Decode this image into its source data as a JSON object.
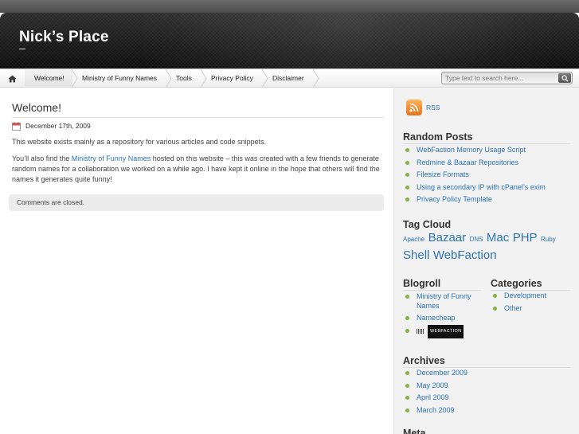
{
  "site": {
    "title": "Nick’s Place"
  },
  "nav": {
    "home_icon": "home-icon",
    "items": [
      {
        "label": "Welcome!"
      },
      {
        "label": "Ministry of Funny Names"
      },
      {
        "label": "Tools"
      },
      {
        "label": "Privacy Policy"
      },
      {
        "label": "Disclaimer"
      }
    ],
    "search": {
      "placeholder": "Type text to search here...",
      "button_icon": "magnifier-icon"
    }
  },
  "post": {
    "title": "Welcome!",
    "date": "December 17th, 2009",
    "paragraph1": "This website exists mainly as a repository for various articles and code snippets.",
    "paragraph2_before": "You’ll also find the ",
    "paragraph2_link": "Ministry of Funny Names",
    "paragraph2_after": " hosted on this website – this was created with a few friends to generate random names for a collaboration we worked on a while ago. I have kept it online in the hope that others will find the names it generates quite funny!",
    "comments_closed": "Comments are closed."
  },
  "sidebar": {
    "rss_label": "RSS",
    "random_posts": {
      "title": "Random Posts",
      "items": [
        {
          "label": "WebFaction Memory Usage Script"
        },
        {
          "label": "Redmine & Bazaar Repositories"
        },
        {
          "label": "Filesize Formats"
        },
        {
          "label": "Using a secondary IP with cPanel’s exim"
        },
        {
          "label": "Privacy Policy Template"
        }
      ]
    },
    "tag_cloud": {
      "title": "Tag Cloud",
      "tags": [
        {
          "label": "Apache",
          "size": "small"
        },
        {
          "label": "Bazaar",
          "size": "large"
        },
        {
          "label": "DNS",
          "size": "small"
        },
        {
          "label": "Mac",
          "size": "large"
        },
        {
          "label": "PHP",
          "size": "large"
        },
        {
          "label": "Ruby",
          "size": "small"
        },
        {
          "label": "Shell",
          "size": "large"
        },
        {
          "label": "WebFaction",
          "size": "large"
        }
      ]
    },
    "blogroll": {
      "title": "Blogroll",
      "items": [
        {
          "label": "Ministry of Funny Names"
        },
        {
          "label": "Namecheap"
        }
      ],
      "badge_text": "WEBFACTION"
    },
    "categories": {
      "title": "Categories",
      "items": [
        {
          "label": "Development"
        },
        {
          "label": "Other"
        }
      ]
    },
    "archives": {
      "title": "Archives",
      "items": [
        {
          "label": "December 2009"
        },
        {
          "label": "May 2009"
        },
        {
          "label": "April 2009"
        },
        {
          "label": "March 2009"
        }
      ]
    },
    "meta_title_partial": "Meta"
  },
  "colors": {
    "link": "#2a73b8",
    "bullet": "#7cb342",
    "header_dark": "#161616",
    "rss_orange": "#e6731d"
  }
}
